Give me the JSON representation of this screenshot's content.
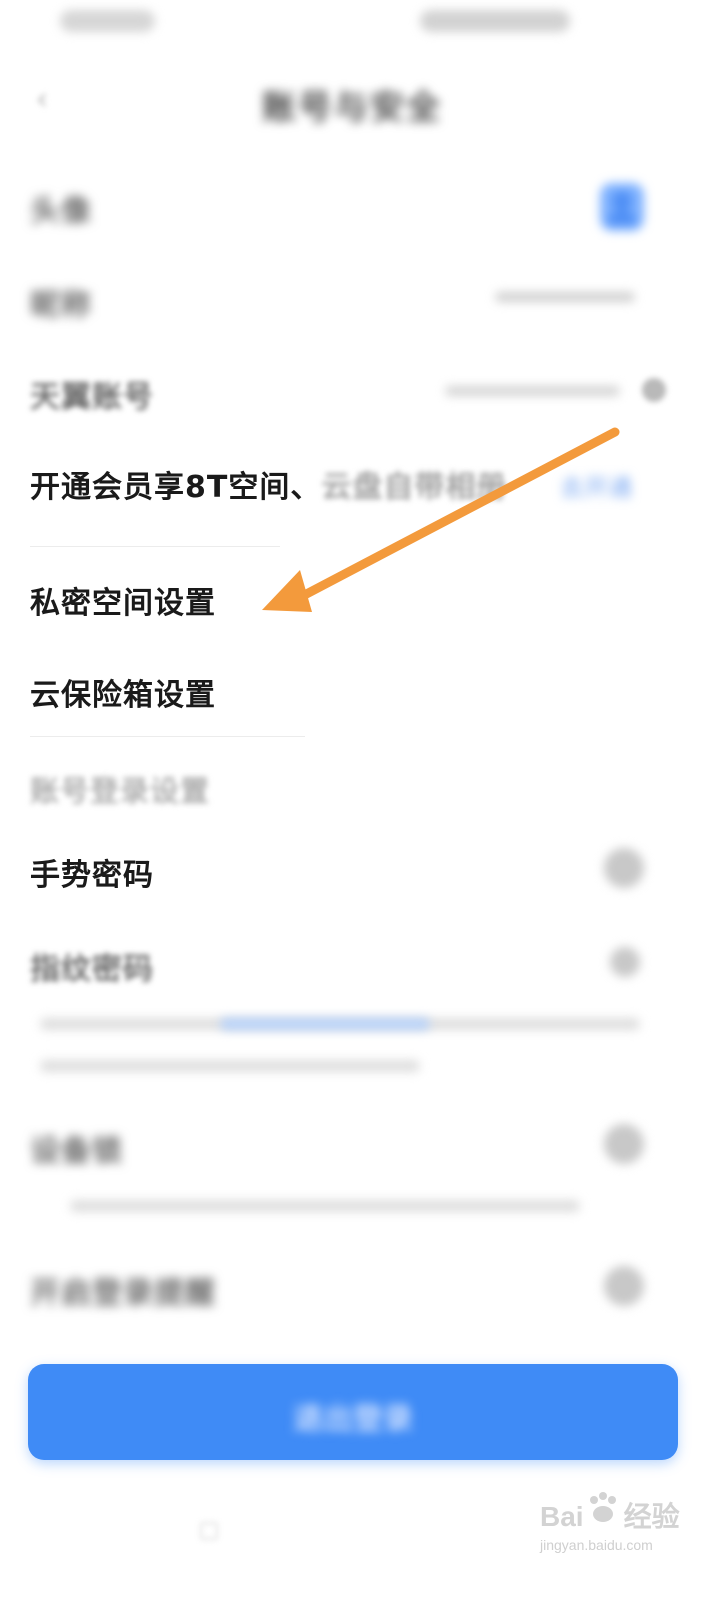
{
  "header": {
    "title": "账号与安全"
  },
  "rows": {
    "avatar_label": "头像",
    "nickname_label": "昵称",
    "nickname_value": "",
    "account_label": "天翼账号",
    "account_value": "",
    "vip_text_main": "开通会员享8T空间、",
    "vip_text_faded": "云盘自带相册",
    "vip_link": "去开通",
    "private_space": "私密空间设置",
    "cloud_safe": "云保险箱设置",
    "login_section": "账号登录设置",
    "gesture_password": "手势密码",
    "fingerprint_password": "指纹密码",
    "device_lock": "设备锁",
    "login_reminder": "开启登录提醒"
  },
  "footer": {
    "logout_label": "退出登录"
  },
  "watermark": {
    "brand_left": "Bai",
    "brand_right": "经验",
    "domain": "jingyan.baidu.com"
  },
  "annotation": {
    "arrow_color": "#F39A3C"
  },
  "colors": {
    "accent": "#3F8BF6"
  },
  "icons": [
    "back-arrow-icon",
    "avatar-icon",
    "info-icon",
    "toggle-icon",
    "arrow-annotation-icon",
    "baidu-paw-icon"
  ]
}
